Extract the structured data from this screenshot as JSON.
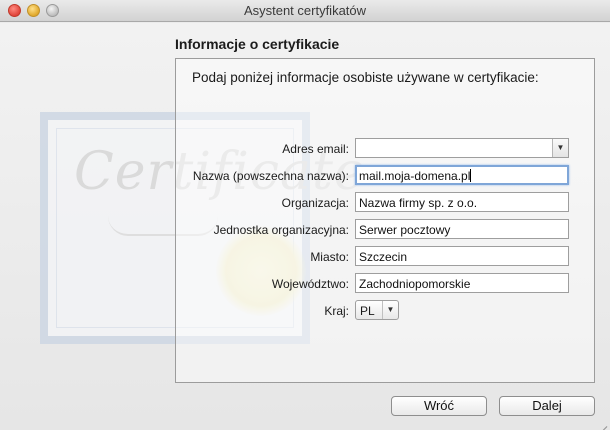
{
  "window": {
    "title": "Asystent certyfikatów"
  },
  "watermark": {
    "text": "Certificate"
  },
  "section": {
    "title": "Informacje o certyfikacie",
    "instructions": "Podaj poniżej informacje osobiste używane w certyfikacie:"
  },
  "form": {
    "email": {
      "label": "Adres email:",
      "value": ""
    },
    "common_name": {
      "label": "Nazwa (powszechna nazwa):",
      "value": "mail.moja-domena.pl"
    },
    "organization": {
      "label": "Organizacja:",
      "value": "Nazwa firmy sp. z o.o."
    },
    "org_unit": {
      "label": "Jednostka organizacyjna:",
      "value": "Serwer pocztowy"
    },
    "city": {
      "label": "Miasto:",
      "value": "Szczecin"
    },
    "province": {
      "label": "Województwo:",
      "value": "Zachodniopomorskie"
    },
    "country": {
      "label": "Kraj:",
      "value": "PL"
    }
  },
  "buttons": {
    "back": "Wróć",
    "next": "Dalej"
  },
  "icons": {
    "combo_arrow": "chevron-down-icon",
    "popup_arrow": "chevron-down-icon"
  }
}
